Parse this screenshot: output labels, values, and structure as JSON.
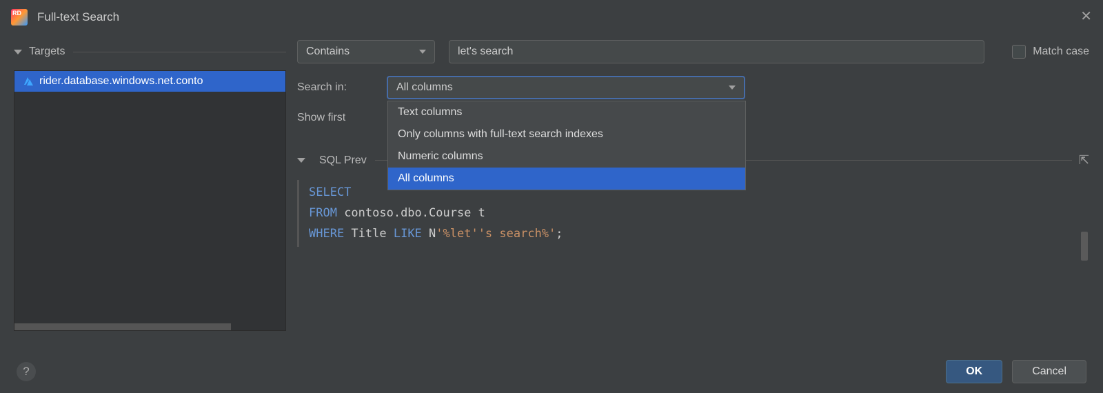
{
  "window": {
    "title": "Full-text Search"
  },
  "sidebar": {
    "header": "Targets",
    "items": [
      {
        "label": "rider.database.windows.net.conto"
      }
    ]
  },
  "search": {
    "mode": "Contains",
    "query": "let's search",
    "match_case_label": "Match case"
  },
  "search_in": {
    "label": "Search in:",
    "selected": "All columns",
    "options": [
      "Text columns",
      "Only columns with full-text search indexes",
      "Numeric columns",
      "All columns"
    ]
  },
  "show_first": {
    "label": "Show first"
  },
  "preview": {
    "header": "SQL Prev",
    "code": {
      "line1": {
        "kw": "SELECT"
      },
      "line2": {
        "kw": "FROM",
        "rest": " contoso.dbo.Course t"
      },
      "line3": {
        "kw1": "WHERE",
        "mid": " Title ",
        "kw2": "LIKE",
        "sp": " N",
        "str": "'%let''s search%'",
        "end": ";"
      }
    }
  },
  "footer": {
    "ok": "OK",
    "cancel": "Cancel"
  }
}
